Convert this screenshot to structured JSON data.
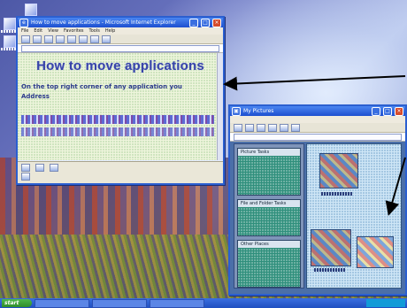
{
  "window_a": {
    "title": "How to move applications - Microsoft Internet Explorer",
    "menu": [
      "File",
      "Edit",
      "View",
      "Favorites",
      "Tools",
      "Help"
    ],
    "headline": "How to move applications",
    "body_text": "On the top right corner of any application you",
    "body_text_2": "Address"
  },
  "window_b": {
    "title": "My Pictures",
    "panels": [
      "Picture Tasks",
      "File and Folder Tasks",
      "Other Places"
    ]
  },
  "taskbar": {
    "start_label": "start"
  },
  "colors": {
    "titlebar": "#1d4fcf",
    "headline": "#3844a8",
    "arrow": "#000000"
  }
}
